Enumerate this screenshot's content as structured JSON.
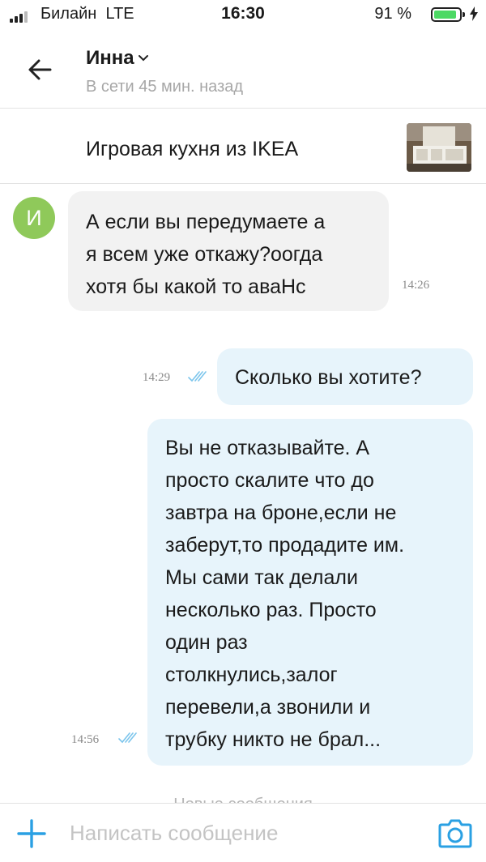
{
  "status_bar": {
    "carrier": "Билайн",
    "network": "LTE",
    "time": "16:30",
    "battery_percent": "91 %",
    "battery_level": 0.91,
    "battery_color": "#4cd964"
  },
  "header": {
    "contact_name": "Инна",
    "contact_status": "В сети 45 мин. назад",
    "back_icon": "arrow-left-icon",
    "dropdown_icon": "chevron-down-icon"
  },
  "listing": {
    "title": "Игровая кухня из IKEA",
    "thumbnail_icon": "listing-photo"
  },
  "messages": [
    {
      "direction": "incoming",
      "avatar_letter": "И",
      "avatar_color": "#8fc95a",
      "lines": [
        "А если вы передумаете а",
        "я всем уже откажу?оогда",
        "хотя бы какой то аваНс"
      ],
      "time": "14:26"
    },
    {
      "direction": "outgoing",
      "lines": [
        "Сколько вы хотите?"
      ],
      "time": "14:29",
      "read": true
    },
    {
      "direction": "outgoing",
      "lines": [
        "Вы не отказывайте. А",
        "просто скалите что до",
        "завтра на броне,если не",
        "заберут,то продадите им.",
        "Мы сами так делали",
        "несколько раз. Просто",
        "один раз",
        "столкнулись,залог",
        "перевели,а звонили и",
        "трубку никто не брал..."
      ],
      "time": "14:56",
      "read": true
    }
  ],
  "divider": {
    "label": "Новые сообщения"
  },
  "composer": {
    "placeholder": "Написать сообщение",
    "value": "",
    "attach_icon": "plus-icon",
    "camera_icon": "camera-icon",
    "accent_color": "#2aa0e3"
  },
  "colors": {
    "incoming_bubble": "#f2f2f2",
    "outgoing_bubble": "#e7f4fb",
    "read_ticks": "#7cc5ec"
  }
}
